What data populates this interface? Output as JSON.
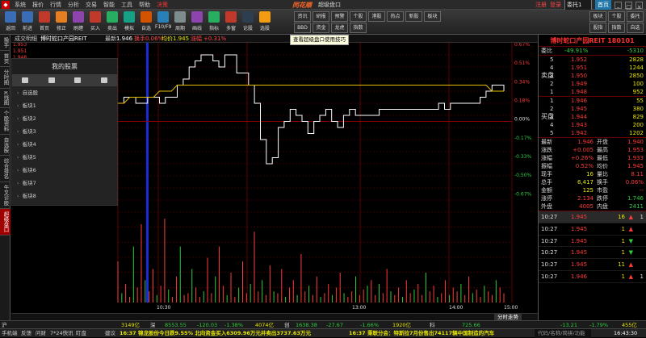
{
  "menubar": {
    "items": [
      "系统",
      "报价",
      "行情",
      "分析",
      "交易",
      "智能",
      "工具",
      "帮助"
    ],
    "decision": "决策",
    "brand": "同花顺",
    "window_title": "超级盘口",
    "register": "注册",
    "login": "登录",
    "search_box": "委托1",
    "account": "首页",
    "quick_links": [
      "委托",
      "自选",
      "资讯",
      "理财"
    ]
  },
  "toolbar": {
    "buttons": [
      {
        "label": "返回",
        "color": "#3a6db5"
      },
      {
        "label": "前进",
        "color": "#3a6db5"
      },
      {
        "label": "首页",
        "color": "#c0392b"
      },
      {
        "label": "修正",
        "color": "#e67e22"
      },
      {
        "label": "刷缠",
        "color": "#8e44ad"
      },
      {
        "label": "买入",
        "color": "#c0392b"
      },
      {
        "label": "卖出",
        "color": "#27ae60"
      },
      {
        "label": "模拟",
        "color": "#16a085"
      },
      {
        "label": "自选",
        "color": "#d35400"
      },
      {
        "label": "F10/F9",
        "color": "#2980b9"
      },
      {
        "label": "周期",
        "color": "#7f8c8d"
      },
      {
        "label": "画线",
        "color": "#8e44ad"
      },
      {
        "label": "指标",
        "color": "#27ae60"
      },
      {
        "label": "多窗",
        "color": "#c0392b"
      },
      {
        "label": "论股",
        "color": "#2c3e50"
      },
      {
        "label": "选股",
        "color": "#f39c12"
      }
    ],
    "grid_buttons": [
      [
        "资讯",
        "BBD",
        "港股"
      ],
      [
        "研报",
        "资金",
        "热点"
      ],
      [
        "预警",
        "龙虎",
        "新股"
      ],
      [
        "个股",
        "指数",
        "板块"
      ]
    ],
    "right_grid": [
      [
        "板块",
        "股指",
        "英雄"
      ],
      [
        "个股",
        "指数",
        "期货"
      ],
      [
        "委托",
        "自选",
        "理财"
      ]
    ]
  },
  "sidebar_nav": [
    "换手",
    "首页",
    "分时图",
    "K线图",
    "个股资料",
    "自选股",
    "综合排名",
    "牛叉诊股",
    "超级盘口"
  ],
  "chart_header": {
    "title_label": "成交明细",
    "stock_name": "博时蛇口产园REIT",
    "latest_label": "最新:",
    "latest_value": "1.946",
    "change_label": "换手",
    "change_value": "0.06%",
    "avg_label": "均价",
    "avg_value": "1.945",
    "amplitude_label": "涨幅",
    "amplitude_value": "+0.31%",
    "tip_button": "查看超级盘口使用技巧"
  },
  "my_stocks": {
    "title": "我的股票",
    "groups": [
      "自选股",
      "板块1",
      "板块2",
      "板块3",
      "板块4",
      "板块5",
      "板块6",
      "板块7",
      "板块8"
    ]
  },
  "chart_data": {
    "type": "line",
    "title": "",
    "x_ticks": [
      "10:30",
      "13:00",
      "14:00",
      "15:00"
    ],
    "y_left": [
      "1.953",
      "1.951",
      "1.948",
      "1.946",
      "1.944",
      "1.942",
      "1.940",
      "1.939"
    ],
    "y_right": [
      "0.67%",
      "0.51%",
      "0.34%",
      "0.18%",
      "0.00%",
      "-0.17%",
      "-0.33%",
      "-0.50%",
      "-0.67%"
    ],
    "prev_close": 1.94,
    "ylim": [
      1.927,
      1.953
    ],
    "series": [
      {
        "values": [
          1.943,
          1.944,
          1.944,
          1.943,
          1.943,
          1.944,
          1.944,
          1.943,
          1.944,
          1.944,
          1.946,
          1.947,
          1.949,
          1.95,
          1.951,
          1.951,
          1.95,
          1.949,
          1.951,
          1.951,
          1.948,
          1.948,
          1.946,
          1.943,
          1.937,
          1.933,
          1.934,
          1.939,
          1.94,
          1.942,
          1.941,
          1.94,
          1.938,
          1.94,
          1.941,
          1.942,
          1.94,
          1.939,
          1.941,
          1.942,
          1.941,
          1.941,
          1.941,
          1.941,
          1.942,
          1.942,
          1.942,
          1.942,
          1.942,
          1.942,
          1.942,
          1.942,
          1.942,
          1.942,
          1.943,
          1.942,
          1.943,
          1.943,
          1.943,
          1.943,
          1.943,
          1.944,
          1.945,
          1.946,
          1.946,
          1.945
        ]
      },
      {
        "values": [
          1.943,
          1.943,
          1.944,
          1.944,
          1.944,
          1.944,
          1.944,
          1.945,
          1.945,
          1.945,
          1.946,
          1.946,
          1.946,
          1.946,
          1.946,
          1.946,
          1.946,
          1.946,
          1.946,
          1.946,
          1.946,
          1.946,
          1.946,
          1.946,
          1.946,
          1.946,
          1.946,
          1.946,
          1.946,
          1.946,
          1.946,
          1.946,
          1.946,
          1.946,
          1.946,
          1.946,
          1.946,
          1.946,
          1.946,
          1.946,
          1.946,
          1.946,
          1.946,
          1.946,
          1.946,
          1.946,
          1.946,
          1.946,
          1.946,
          1.946,
          1.946,
          1.946,
          1.946,
          1.946,
          1.946,
          1.946,
          1.946,
          1.946,
          1.946,
          1.946,
          1.946,
          1.946,
          1.946,
          1.945,
          1.945,
          1.945
        ]
      }
    ],
    "volume": [
      22,
      5,
      10,
      3,
      30,
      8,
      42,
      12,
      6,
      18,
      4,
      9,
      45,
      7,
      3,
      14,
      30,
      4,
      5,
      18,
      8,
      3,
      6,
      24,
      5,
      14,
      30,
      9,
      4,
      16,
      3,
      8,
      22,
      5,
      10,
      38,
      6,
      12,
      4,
      20,
      6,
      5,
      18,
      3,
      8,
      12,
      4,
      26,
      6,
      9,
      4,
      14,
      3,
      5,
      10,
      4,
      8,
      16,
      5,
      3,
      6,
      14,
      4,
      7,
      9,
      12,
      4,
      10,
      5,
      18,
      6,
      4,
      8,
      3,
      12,
      5,
      7,
      10,
      4,
      16,
      6,
      9,
      3,
      5,
      12,
      4,
      8,
      6,
      10,
      4,
      14,
      5,
      7,
      3,
      9,
      6,
      4,
      12,
      8,
      5
    ]
  },
  "quote_panel": {
    "title": "博时蛇口产园REIT 180101",
    "weibi_label": "委比",
    "weibi_value": "-49.91%",
    "weicha_value": "-5310",
    "sell": [
      {
        "lvl": "5",
        "price": "1.952",
        "vol": "2828"
      },
      {
        "lvl": "4",
        "price": "1.951",
        "vol": "1244"
      },
      {
        "lvl": "3",
        "price": "1.950",
        "vol": "2850"
      },
      {
        "lvl": "2",
        "price": "1.949",
        "vol": "100"
      },
      {
        "lvl": "1",
        "price": "1.948",
        "vol": "952"
      }
    ],
    "buy": [
      {
        "lvl": "1",
        "price": "1.946",
        "vol": "55"
      },
      {
        "lvl": "2",
        "price": "1.945",
        "vol": "380"
      },
      {
        "lvl": "3",
        "price": "1.944",
        "vol": "829"
      },
      {
        "lvl": "4",
        "price": "1.943",
        "vol": "200"
      },
      {
        "lvl": "5",
        "price": "1.942",
        "vol": "1202"
      }
    ],
    "sell_mark": "卖盘",
    "buy_mark": "买盘",
    "stats": [
      [
        "最新",
        "1.946",
        "开盘",
        "1.940"
      ],
      [
        "涨跌",
        "+0.005",
        "最高",
        "1.953"
      ],
      [
        "涨幅",
        "+0.26%",
        "最低",
        "1.933"
      ],
      [
        "振幅",
        "0.52%",
        "均价",
        "1.945"
      ],
      [
        "现手",
        "16",
        "量比",
        "8.11"
      ],
      [
        "总手",
        "6,417",
        "换手",
        "0.06%"
      ],
      [
        "金额",
        "125",
        "市盈",
        "--"
      ],
      [
        "涨停",
        "2.134",
        "跌停",
        "1.746"
      ],
      [
        "外盘",
        "4005",
        "内盘",
        "2411"
      ]
    ],
    "ticks": [
      {
        "time": "10:27",
        "price": "1.945",
        "vol": "16",
        "arrow": "up",
        "flag": "1"
      },
      {
        "time": "10:27",
        "price": "1.945",
        "vol": "1",
        "arrow": "up",
        "flag": ""
      },
      {
        "time": "10:27",
        "price": "1.945",
        "vol": "1",
        "arrow": "down",
        "flag": ""
      },
      {
        "time": "10:27",
        "price": "1.945",
        "vol": "1",
        "arrow": "down",
        "flag": ""
      },
      {
        "time": "10:27",
        "price": "1.945",
        "vol": "11",
        "arrow": "up",
        "flag": ""
      },
      {
        "time": "10:27",
        "price": "1.946",
        "vol": "1",
        "arrow": "up",
        "flag": "1"
      }
    ]
  },
  "bottom_tabs": [
    "分时走势"
  ],
  "index_bar": [
    {
      "label": "沪",
      "value": "3149亿",
      "change": "",
      "color": "#ff3b3b"
    },
    {
      "label": "深",
      "value": "8553.55",
      "change": "-120.03",
      "pct": "-1.38%",
      "amount": "4074亿"
    },
    {
      "label": "创",
      "value": "1638.38",
      "change": "-27.67",
      "pct": "-1.66%",
      "amount": "1920亿"
    },
    {
      "label": "科",
      "value": "725.66",
      "change": "-13.21",
      "pct": "-1.79%",
      "amount": "455亿"
    }
  ],
  "ticker": {
    "news1": "16:37 锦龙股份今日跌9.55% 北向资金买入6309.96万元并卖出3737.63万元",
    "news2": "16:37 秉联分会：特斯拉7月份售出74117辆中国制造的汽车",
    "search_hint": "代码/名称/简拼/功能"
  },
  "statusbar": {
    "items": [
      "手机端",
      "反馈",
      "问财",
      "7*24快讯",
      "盯盘",
      "建议"
    ],
    "clock": "16:43:30"
  }
}
